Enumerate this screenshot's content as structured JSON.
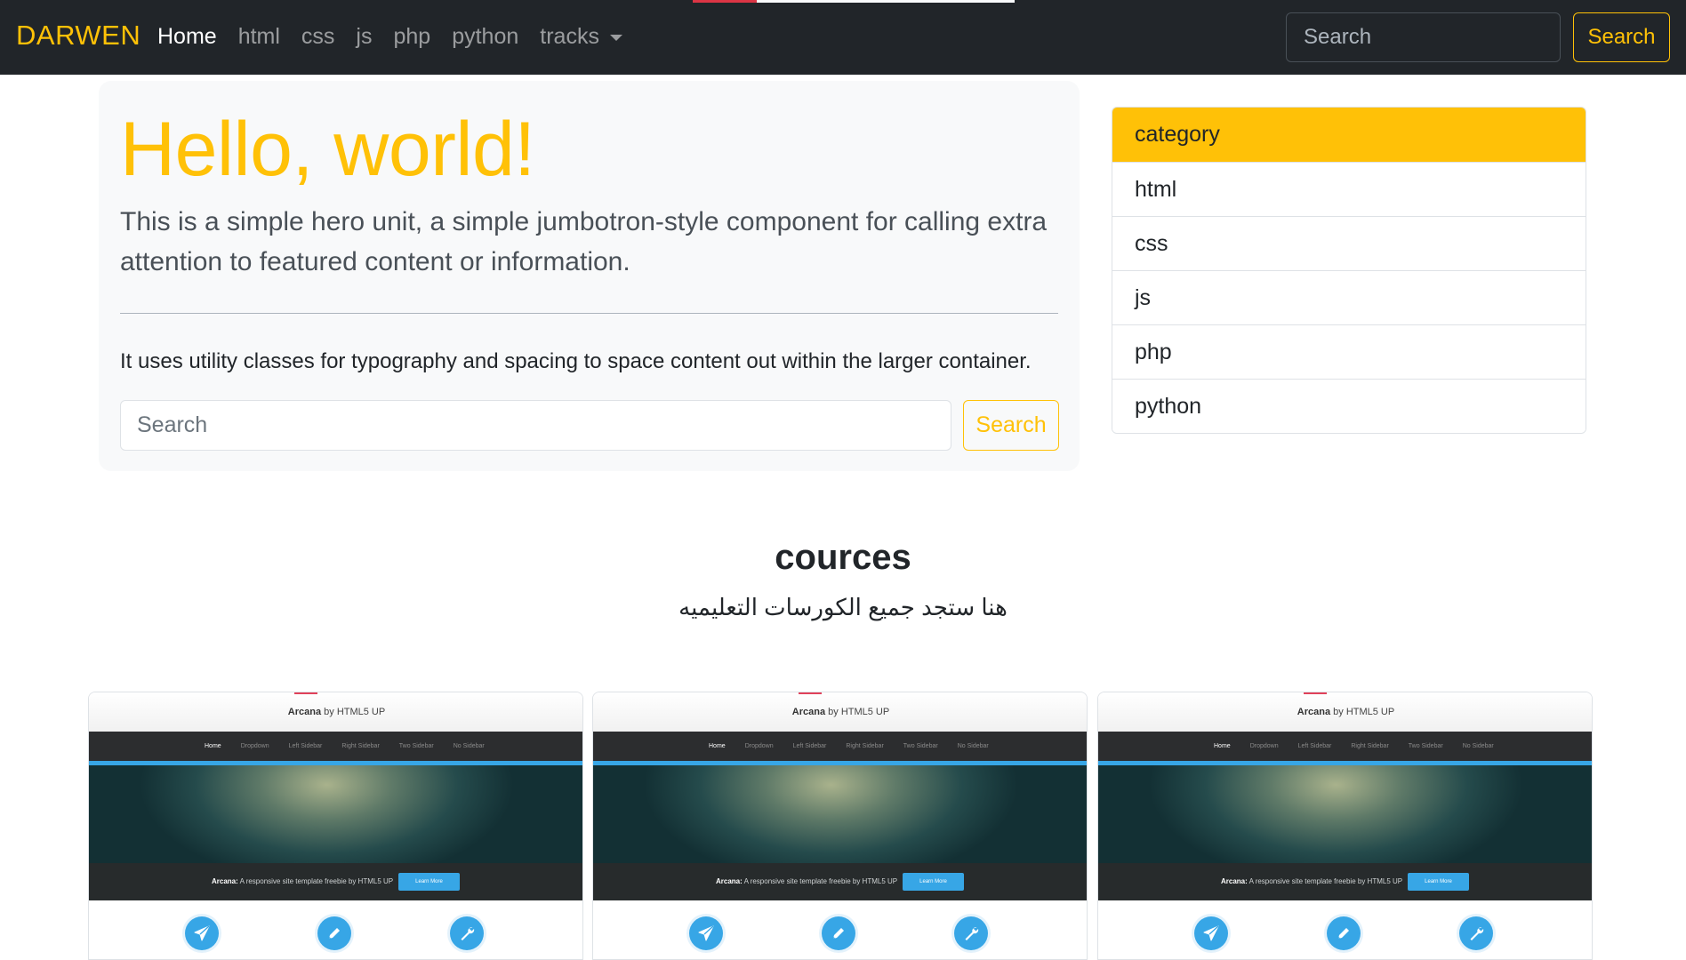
{
  "navbar": {
    "brand": "DARWEN",
    "links": [
      "Home",
      "html",
      "css",
      "js",
      "php",
      "python"
    ],
    "dropdown": "tracks",
    "search_placeholder": "Search",
    "search_button": "Search"
  },
  "jumbotron": {
    "title": "Hello, world!",
    "lead": "This is a simple hero unit, a simple jumbotron-style component for calling extra attention to featured content or information.",
    "text": "It uses utility classes for typography and spacing to space content out within the larger container.",
    "search_placeholder": "Search",
    "search_button": "Search"
  },
  "categories": {
    "header": "category",
    "items": [
      "html",
      "css",
      "js",
      "php",
      "python"
    ]
  },
  "courses": {
    "title": "cources",
    "subtitle": "هنا ستجد جميع الكورسات التعليميه"
  },
  "thumbnail": {
    "brand_name": "Arcana",
    "brand_by": "by HTML5 UP",
    "nav": [
      "Home",
      "Dropdown",
      "Left Sidebar",
      "Right Sidebar",
      "Two Sidebar",
      "No Sidebar"
    ],
    "banner_name": "Arcana:",
    "banner_text": "A responsive site template freebie by HTML5 UP",
    "button": "Learn More"
  },
  "card_icons": [
    "paper-plane-icon",
    "pencil-icon",
    "wrench-icon"
  ],
  "colors": {
    "navbar_bg": "#212529",
    "accent": "#ffc107",
    "jumbotron_bg": "#f8f9fa",
    "icon_blue": "#37a6e6"
  }
}
